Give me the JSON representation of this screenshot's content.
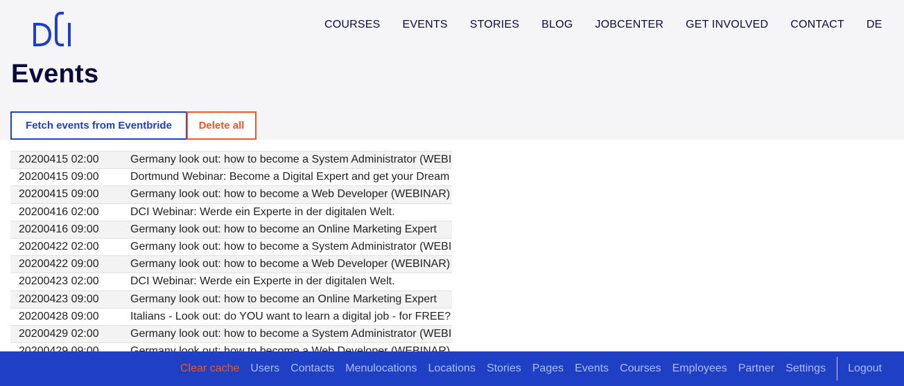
{
  "brand": {
    "logo_alt": "DCI",
    "color": "#1f3fc4"
  },
  "nav": {
    "items": [
      {
        "label": "COURSES"
      },
      {
        "label": "EVENTS"
      },
      {
        "label": "STORIES"
      },
      {
        "label": "BLOG"
      },
      {
        "label": "JOBCENTER"
      },
      {
        "label": "GET INVOLVED"
      },
      {
        "label": "CONTACT"
      },
      {
        "label": "DE"
      }
    ]
  },
  "page": {
    "title": "Events"
  },
  "actions": {
    "fetch_label": "Fetch events from Eventbride",
    "delete_label": "Delete all"
  },
  "events": [
    {
      "date": "20200415 02:00",
      "title": "Germany look out: how to become a System Administrator (WEBINAR)"
    },
    {
      "date": "20200415 09:00",
      "title": "Dortmund Webinar: Become a Digital Expert and get your Dream Job"
    },
    {
      "date": "20200415 09:00",
      "title": "Germany look out: how to become a Web Developer (WEBINAR)"
    },
    {
      "date": "20200416 02:00",
      "title": "DCI Webinar: Werde ein Experte in der digitalen Welt."
    },
    {
      "date": "20200416 09:00",
      "title": "Germany look out: how to become an Online Marketing Expert"
    },
    {
      "date": "20200422 02:00",
      "title": "Germany look out: how to become a System Administrator (WEBINAR)"
    },
    {
      "date": "20200422 09:00",
      "title": "Germany look out: how to become a Web Developer (WEBINAR)"
    },
    {
      "date": "20200423 02:00",
      "title": "DCI Webinar: Werde ein Experte in der digitalen Welt."
    },
    {
      "date": "20200423 09:00",
      "title": "Germany look out: how to become an Online Marketing Expert"
    },
    {
      "date": "20200428 09:00",
      "title": "Italians - Look out: do YOU want to learn a digital job - for FREE?"
    },
    {
      "date": "20200429 02:00",
      "title": "Germany look out: how to become a System Administrator (WEBINAR)"
    },
    {
      "date": "20200429 09:00",
      "title": "Germany look out: how to become a Web Developer (WEBINAR)"
    }
  ],
  "footer": {
    "clear_cache": "Clear cache",
    "links": [
      {
        "label": "Users"
      },
      {
        "label": "Contacts"
      },
      {
        "label": "Menulocations"
      },
      {
        "label": "Locations"
      },
      {
        "label": "Stories"
      },
      {
        "label": "Pages"
      },
      {
        "label": "Events"
      },
      {
        "label": "Courses"
      },
      {
        "label": "Employees"
      },
      {
        "label": "Partner"
      },
      {
        "label": "Settings"
      }
    ],
    "logout": "Logout"
  }
}
